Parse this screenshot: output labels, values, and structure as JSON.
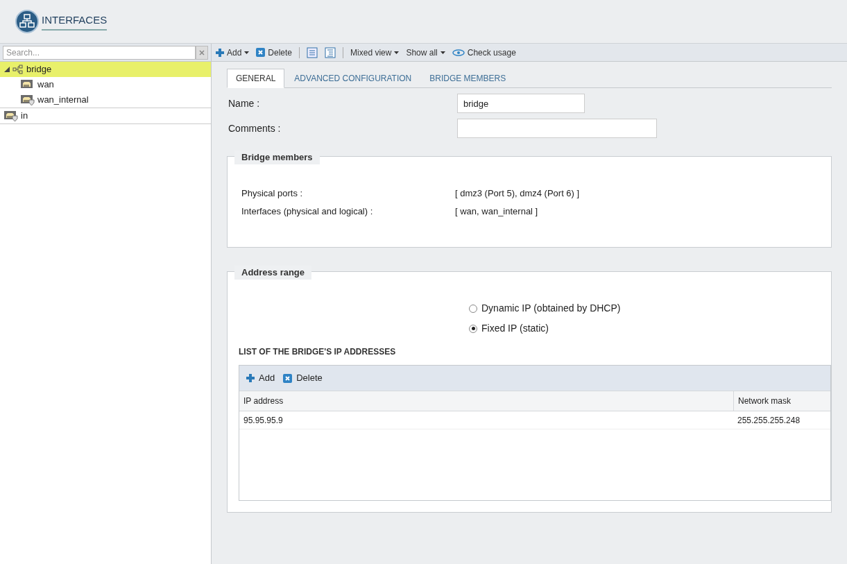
{
  "header": {
    "title": "INTERFACES"
  },
  "search": {
    "placeholder": "Search..."
  },
  "toolbar": [
    {
      "kind": "add",
      "label": "Add",
      "dropdown": true
    },
    {
      "kind": "delete",
      "label": "Delete",
      "dropdown": false
    },
    {
      "kind": "sep"
    },
    {
      "kind": "list-view"
    },
    {
      "kind": "tree-view"
    },
    {
      "kind": "sep"
    },
    {
      "kind": "text",
      "label": "Mixed view",
      "dropdown": true
    },
    {
      "kind": "text",
      "label": "Show all",
      "dropdown": true
    },
    {
      "kind": "eye",
      "label": "Check usage",
      "dropdown": false
    }
  ],
  "tree": [
    {
      "kind": "bridge",
      "label": "bridge",
      "selected": true,
      "expanded": true,
      "children": [
        {
          "kind": "port",
          "label": "wan",
          "selected": false
        },
        {
          "kind": "port-shield",
          "label": "wan_internal",
          "selected": false
        }
      ]
    },
    {
      "kind": "port-shield",
      "label": "in",
      "selected": false
    }
  ],
  "tabs": [
    {
      "label": "GENERAL",
      "selected": true
    },
    {
      "label": "ADVANCED CONFIGURATION",
      "selected": false
    },
    {
      "label": "BRIDGE MEMBERS",
      "selected": false
    }
  ],
  "fields": [
    {
      "label": "Name :",
      "value": "bridge",
      "wide": false
    },
    {
      "label": "Comments :",
      "wide": true
    }
  ],
  "bridge_members": {
    "title": "Bridge members",
    "rows": [
      {
        "label": "Physical ports :",
        "value": "[ dmz3 (Port 5), dmz4 (Port 6) ]"
      },
      {
        "label": "Interfaces (physical and logical) :",
        "value": "[ wan, wan_internal ]"
      }
    ]
  },
  "address_range": {
    "title": "Address range",
    "options": [
      {
        "label": "Dynamic IP (obtained by DHCP)",
        "selected": false
      },
      {
        "label": "Fixed IP (static)",
        "selected": true
      }
    ],
    "list_title": "LIST OF THE BRIDGE'S IP ADDRESSES",
    "grid_toolbar": [
      {
        "kind": "add",
        "label": "Add"
      },
      {
        "kind": "delete",
        "label": "Delete"
      }
    ],
    "columns": [
      "IP address",
      "Network mask"
    ],
    "rows": [
      [
        "95.95.95.9",
        "255.255.255.248"
      ]
    ]
  }
}
